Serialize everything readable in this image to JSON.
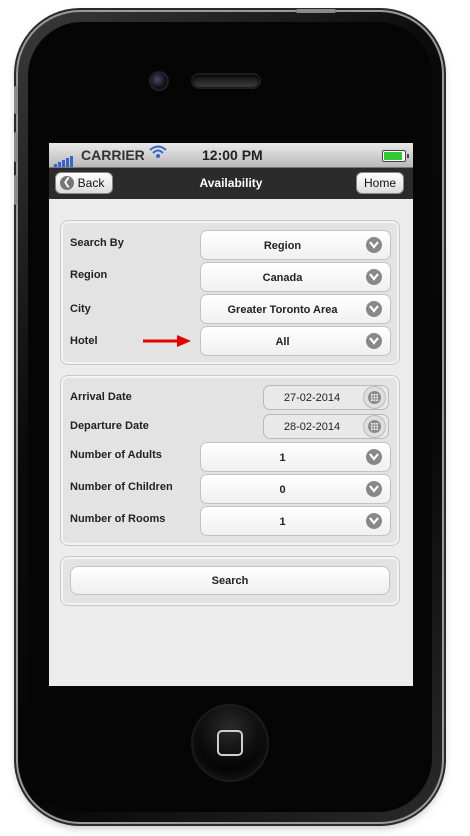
{
  "statusbar": {
    "carrier": "CARRIER",
    "time": "12:00 PM",
    "wifi_icon": "wifi-icon",
    "battery_level": 1.0
  },
  "navbar": {
    "title": "Availability",
    "back_label": "Back",
    "home_label": "Home"
  },
  "search_panel": {
    "rows": [
      {
        "label": "Search By",
        "value": "Region"
      },
      {
        "label": "Region",
        "value": "Canada"
      },
      {
        "label": "City",
        "value": "Greater Toronto Area"
      },
      {
        "label": "Hotel",
        "value": "All"
      }
    ]
  },
  "booking_panel": {
    "arrival_label": "Arrival Date",
    "arrival_value": "27-02-2014",
    "departure_label": "Departure Date",
    "departure_value": "28-02-2014",
    "adults_label": "Number of Adults",
    "adults_value": "1",
    "children_label": "Number of Children",
    "children_value": "0",
    "rooms_label": "Number of Rooms",
    "rooms_value": "1"
  },
  "actions": {
    "search_label": "Search"
  },
  "annotation": {
    "arrow_color": "#e00000"
  }
}
